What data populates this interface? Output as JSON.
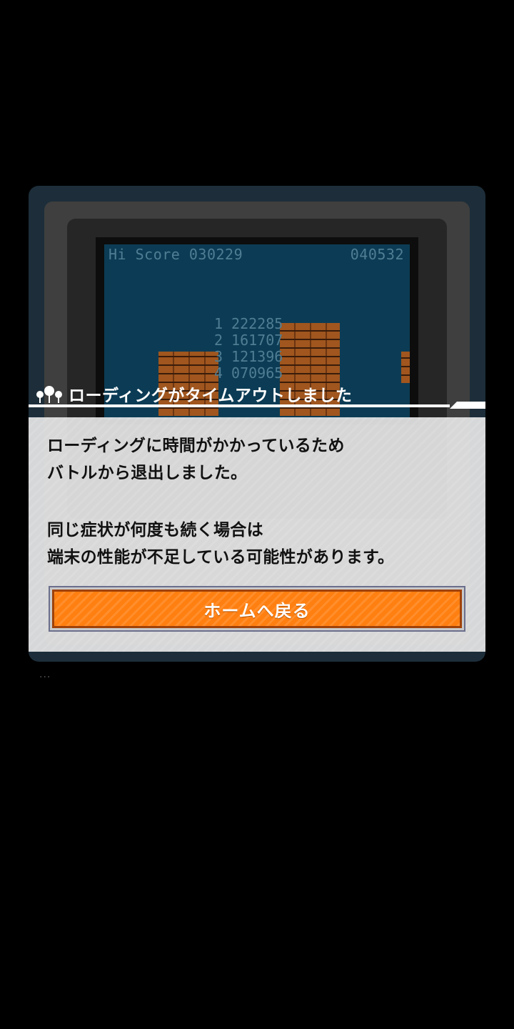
{
  "game_screen": {
    "hud_left": "Hi Score 030229",
    "hud_right": "040532",
    "rankings": [
      {
        "rank": "1",
        "score": "222285"
      },
      {
        "rank": "2",
        "score": "161707"
      },
      {
        "rank": "3",
        "score": "121396"
      },
      {
        "rank": "4",
        "score": "070965"
      }
    ]
  },
  "dialog": {
    "title": "ローディングがタイムアウトしました",
    "message_1": [
      "ローディングに時間がかかっているため",
      "バトルから退出しました。"
    ],
    "message_2": [
      "同じ症状が何度も続く場合は",
      "端末の性能が不足している可能性があります。"
    ],
    "home_button_label": "ホームへ戻る"
  },
  "colors": {
    "accent_orange": "#ff7f10",
    "button_border": "#a0420a",
    "game_bg": "#0c3c55"
  },
  "icons": {
    "title_icon": "speech-bubbles-icon"
  },
  "footer": {
    "dots": "..."
  }
}
